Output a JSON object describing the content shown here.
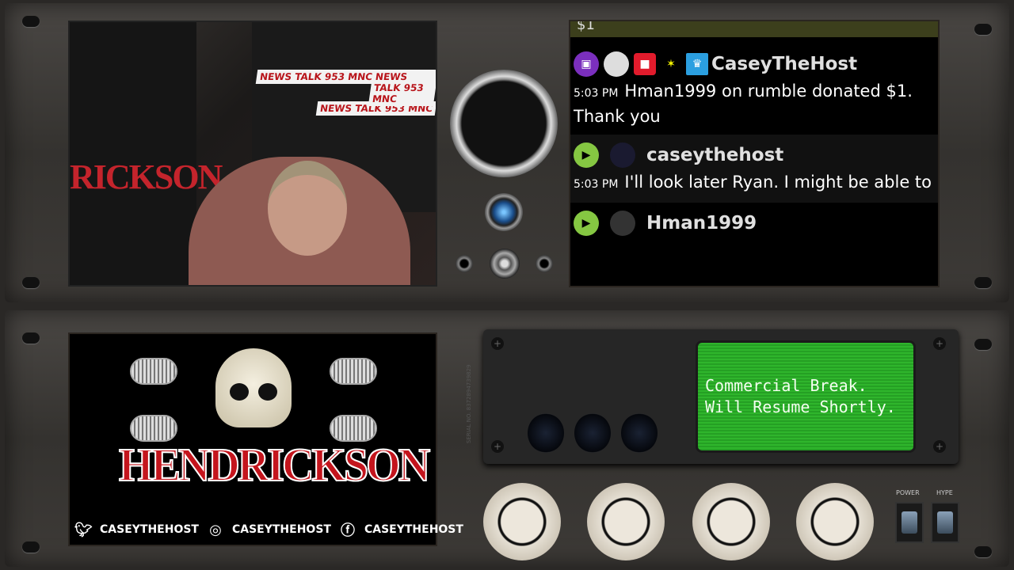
{
  "chat": {
    "top_partial": "$1",
    "messages": [
      {
        "platform": "twitch",
        "username": "CaseyTheHost",
        "time": "5:03 PM",
        "text": "Hman1999 on rumble donated $1. Thank you"
      },
      {
        "platform": "rumble",
        "username": "caseythehost",
        "time": "5:03 PM",
        "text": "I'll look later Ryan. I might be able to"
      },
      {
        "platform": "rumble",
        "username": "Hman1999"
      }
    ],
    "colors": {
      "twitch": "#7b2fbe",
      "rumble": "#85c742"
    }
  },
  "webcam": {
    "backdrop_logo": "NEWS TALK 953 MNC",
    "banner_text": "RICKSON"
  },
  "brand": {
    "logo_text": "HENDRICKSON"
  },
  "socials": [
    {
      "icon": "twitter-icon",
      "handle": "CASEYTHEHOST"
    },
    {
      "icon": "instagram-icon",
      "handle": "CASEYTHEHOST"
    },
    {
      "icon": "facebook-icon",
      "handle": "CASEYTHEHOST"
    }
  ],
  "display": {
    "line1": "Commercial Break.",
    "line2": "Will Resume Shortly.",
    "color": "#2fb52c"
  },
  "panel": {
    "serial": "SERIAL NO. 8372894739829",
    "switch1": "POWER",
    "switch2": "HYPE"
  }
}
